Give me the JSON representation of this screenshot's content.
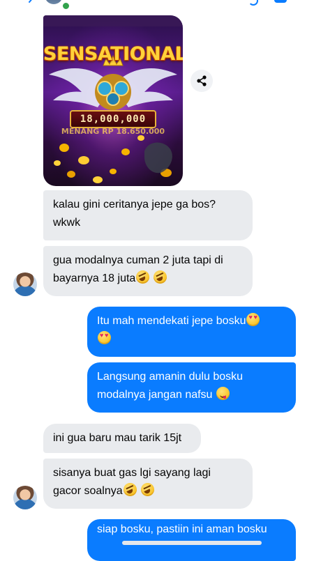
{
  "image_card": {
    "headline": "SENSATIONAL!",
    "amount": "18,000,000",
    "meter_text": "MENANG RP 18.650.000"
  },
  "messages": [
    {
      "id": "m1",
      "side": "incoming",
      "lines": [
        "kalau gini ceritanya jepe ga bos?",
        "wkwk"
      ]
    },
    {
      "id": "m2",
      "side": "incoming",
      "lines": [
        "gua modalnya cuman 2 juta tapi di",
        "bayarnya 18 juta"
      ],
      "trailing_emoji": [
        "rolling-on-floor-laughing",
        "rolling-on-floor-laughing"
      ]
    },
    {
      "id": "m3",
      "side": "outgoing",
      "lines": [
        "Itu mah mendekati jepe bosku"
      ],
      "trailing_emoji": [
        "heart-eyes",
        "heart-eyes"
      ]
    },
    {
      "id": "m4",
      "side": "outgoing",
      "lines": [
        "Langsung amanin dulu bosku",
        "modalnya jangan nafsu"
      ],
      "trailing_emoji": [
        "face-savoring-food"
      ]
    },
    {
      "id": "m5",
      "side": "incoming",
      "lines": [
        "ini gua baru mau tarik 15jt"
      ]
    },
    {
      "id": "m6",
      "side": "incoming",
      "lines": [
        "sisanya buat gas lgi sayang lagi",
        "gacor soalnya"
      ],
      "trailing_emoji": [
        "rolling-on-floor-laughing",
        "rolling-on-floor-laughing"
      ]
    },
    {
      "id": "m7",
      "side": "outgoing",
      "lines": [
        "siap bosku, pastiin ini aman bosku"
      ]
    }
  ],
  "icons": {
    "share": "share-icon",
    "online": "online-status-dot"
  },
  "colors": {
    "outgoing_bubble": "#0a7cff",
    "incoming_bubble": "#e9ebee",
    "online_dot": "#31a24c",
    "page_background": "#ffffff"
  }
}
